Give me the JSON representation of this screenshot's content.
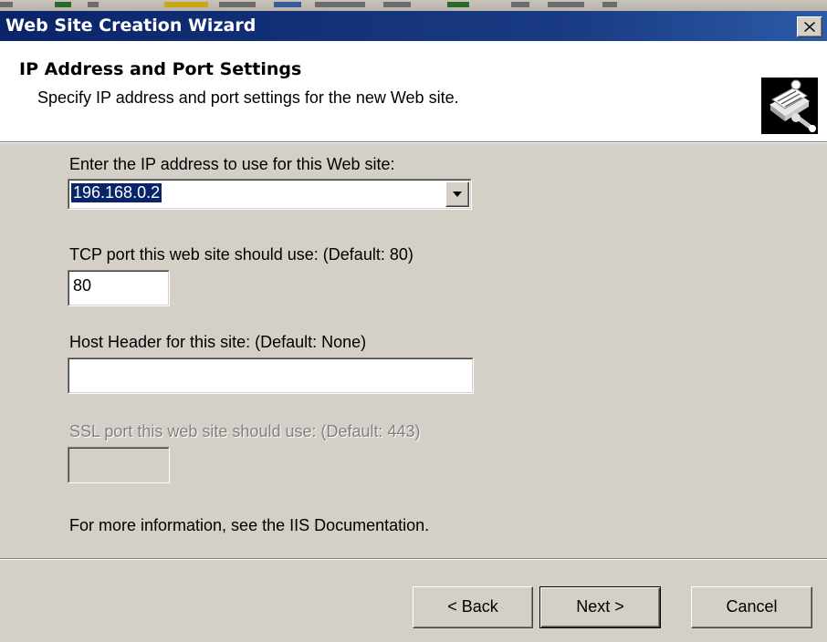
{
  "window": {
    "title": "Web Site Creation Wizard"
  },
  "header": {
    "title": "IP Address and Port Settings",
    "subtitle": "Specify IP address and port settings for the new Web site.",
    "icon": "wizard-book-icon"
  },
  "form": {
    "ip_label": "Enter the IP address to use for this Web site:",
    "ip_value": "196.168.0.2",
    "tcp_label": "TCP port this web site should use: (Default: 80)",
    "tcp_value": "80",
    "host_label": "Host Header for this site: (Default: None)",
    "host_value": "",
    "ssl_label": "SSL port this web site should use: (Default: 443)",
    "ssl_value": "",
    "info_text": "For more information, see the IIS Documentation."
  },
  "buttons": {
    "back": "< Back",
    "next": "Next >",
    "cancel": "Cancel"
  },
  "colors": {
    "title_bar": "#0a246a",
    "dialog_bg": "#d4d0c8",
    "selection": "#0a246a"
  }
}
